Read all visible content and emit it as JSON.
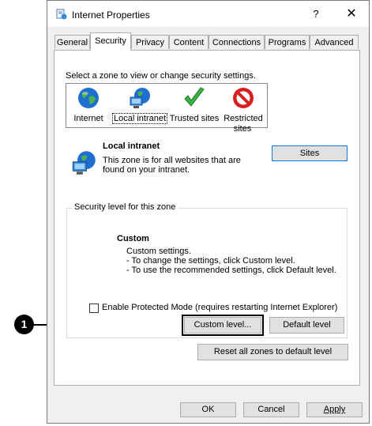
{
  "window": {
    "title": "Internet Properties",
    "help_glyph": "?",
    "close_glyph": "✕"
  },
  "tabs": [
    {
      "label": "General",
      "active": false
    },
    {
      "label": "Security",
      "active": true
    },
    {
      "label": "Privacy",
      "active": false
    },
    {
      "label": "Content",
      "active": false
    },
    {
      "label": "Connections",
      "active": false
    },
    {
      "label": "Programs",
      "active": false
    },
    {
      "label": "Advanced",
      "active": false
    }
  ],
  "security": {
    "zone_prompt": "Select a zone to view or change security settings.",
    "zones": [
      {
        "label": "Internet",
        "icon": "globe-icon",
        "selected": false
      },
      {
        "label": "Local intranet",
        "icon": "intranet-icon",
        "selected": true
      },
      {
        "label": "Trusted sites",
        "icon": "checkmark-icon",
        "selected": false
      },
      {
        "label_line1": "Restricted",
        "label_line2": "sites",
        "icon": "restricted-icon",
        "selected": false
      }
    ],
    "selected_zone": {
      "name": "Local intranet",
      "desc_line1": "This zone is for all websites that are",
      "desc_line2": "found on your intranet.",
      "sites_button": "Sites"
    },
    "level_group": {
      "legend": "Security level for this zone",
      "level_name": "Custom",
      "line1": "Custom settings.",
      "line2": "- To change the settings, click Custom level.",
      "line3": "- To use the recommended settings, click Default level."
    },
    "protected_mode": {
      "label": "Enable Protected Mode (requires restarting Internet Explorer)",
      "checked": false
    },
    "custom_level_button": "Custom level...",
    "default_level_button": "Default level",
    "reset_all_button": "Reset all zones to default level"
  },
  "footer": {
    "ok": "OK",
    "cancel": "Cancel",
    "apply": "Apply"
  },
  "callout": {
    "number": "1"
  },
  "colors": {
    "accent": "#0078d7",
    "globe_blue": "#1e6fd0",
    "check_green": "#3cb043",
    "restricted_red": "#d81e1e"
  }
}
